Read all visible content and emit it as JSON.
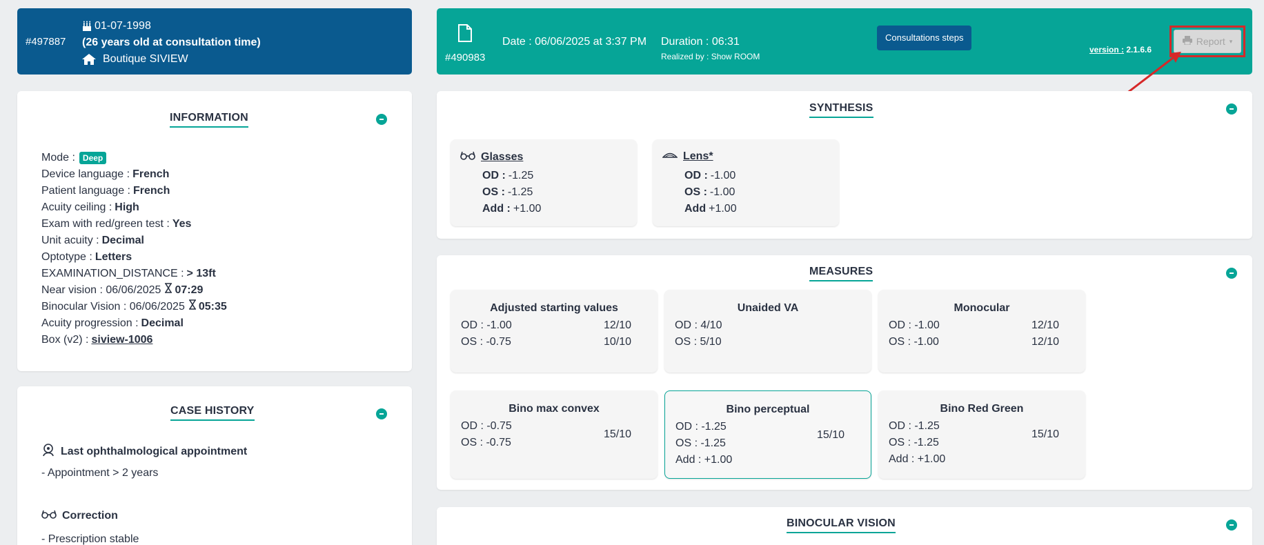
{
  "patient": {
    "id": "#497887",
    "birthdate": "01-07-1998",
    "age_text": "(26 years old at consultation time)",
    "store": "Boutique SIVIEW"
  },
  "consultation": {
    "id": "#490983",
    "date": "Date : 06/06/2025 at 3:37 PM",
    "duration": "Duration : 06:31",
    "realized_by": "Realized by : Show ROOM",
    "steps_button": "Consultations steps",
    "version_label": "version :",
    "version_value": "2.1.6.6",
    "report_button": "Report"
  },
  "information": {
    "title": "INFORMATION",
    "mode_label": "Mode :",
    "mode_badge": "Deep",
    "rows": [
      {
        "label": "Device language :",
        "value": "French"
      },
      {
        "label": "Patient language :",
        "value": "French"
      },
      {
        "label": "Acuity ceiling :",
        "value": "High"
      },
      {
        "label": "Exam with red/green test :",
        "value": "Yes"
      },
      {
        "label": "Unit acuity :",
        "value": "Decimal"
      },
      {
        "label": "Optotype :",
        "value": "Letters"
      },
      {
        "label": "EXAMINATION_DISTANCE :",
        "value": "> 13ft"
      }
    ],
    "near_vision": {
      "label": "Near vision : 06/06/2025",
      "value": "07:29"
    },
    "binocular_vision": {
      "label": "Binocular Vision : 06/06/2025",
      "value": "05:35"
    },
    "acuity_progression": {
      "label": "Acuity progression :",
      "value": "Decimal"
    },
    "box": {
      "label": "Box (v2) :",
      "value": "siview-1006"
    }
  },
  "case_history": {
    "title": "CASE HISTORY",
    "sections": [
      {
        "heading": "Last ophthalmological appointment",
        "text": "- Appointment > 2 years",
        "icon": "doctor-icon"
      },
      {
        "heading": "Correction",
        "text": "- Prescription stable",
        "icon": "glasses-icon"
      }
    ]
  },
  "synthesis": {
    "title": "SYNTHESIS",
    "cards": [
      {
        "title": "Glasses",
        "icon": "glasses-icon",
        "od_label": "OD :",
        "od": "-1.25",
        "os_label": "OS :",
        "os": "-1.25",
        "add_label": "Add :",
        "add": "+1.00"
      },
      {
        "title": "Lens*",
        "icon": "lens-icon",
        "od_label": "OD :",
        "od": "-1.00",
        "os_label": "OS :",
        "os": "-1.00",
        "add_label": "Add",
        "add": "+1.00"
      }
    ]
  },
  "measures": {
    "title": "MEASURES",
    "cards": [
      {
        "title": "Adjusted starting values",
        "od": "OD : -1.00",
        "od_right": "12/10",
        "os": "OS : -0.75",
        "os_right": "10/10"
      },
      {
        "title": "Unaided VA",
        "od": "OD : 4/10",
        "os": "OS : 5/10"
      },
      {
        "title": "Monocular",
        "od": "OD : -1.00",
        "od_right": "12/10",
        "os": "OS : -1.00",
        "os_right": "12/10"
      },
      {
        "title": "Bino max convex",
        "od": "OD : -0.75",
        "os": "OS : -0.75",
        "right": "15/10"
      },
      {
        "title": "Bino perceptual",
        "od": "OD : -1.25",
        "os": "OS : -1.25",
        "add": "Add : +1.00",
        "right": "15/10"
      },
      {
        "title": "Bino Red Green",
        "od": "OD : -1.25",
        "os": "OS : -1.25",
        "add": "Add : +1.00",
        "right": "15/10"
      }
    ]
  },
  "binocular": {
    "title": "BINOCULAR VISION"
  }
}
